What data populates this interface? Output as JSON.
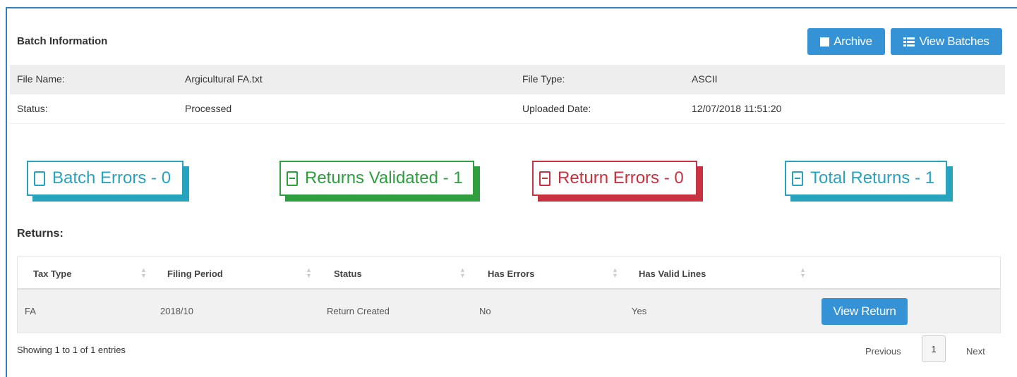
{
  "header": {
    "title": "Batch Information",
    "archive_label": "Archive",
    "view_batches_label": "View Batches"
  },
  "info": {
    "file_name_label": "File Name:",
    "file_name_value": "Argicultural FA.txt",
    "file_type_label": "File Type:",
    "file_type_value": "ASCII",
    "status_label": "Status:",
    "status_value": "Processed",
    "uploaded_label": "Uploaded Date:",
    "uploaded_value": "12/07/2018 11:51:20"
  },
  "stats": {
    "batch_errors": "Batch Errors - 0",
    "returns_validated": "Returns Validated - 1",
    "return_errors": "Return Errors - 0",
    "total_returns": "Total Returns - 1",
    "colors": {
      "teal": "#28a3bd",
      "green": "#2e9e3f",
      "red": "#c8313f"
    }
  },
  "returns": {
    "label": "Returns:",
    "columns": [
      "Tax Type",
      "Filing Period",
      "Status",
      "Has Errors",
      "Has Valid Lines"
    ],
    "rows": [
      {
        "tax_type": "FA",
        "filing_period": "2018/10",
        "status": "Return Created",
        "has_errors": "No",
        "has_valid_lines": "Yes",
        "action_label": "View Return"
      }
    ]
  },
  "footer": {
    "showing": "Showing 1 to 1 of 1 entries",
    "previous": "Previous",
    "page": "1",
    "next": "Next"
  },
  "theme": {
    "primary": "#3592d5",
    "frame": "#2f7fc1"
  }
}
